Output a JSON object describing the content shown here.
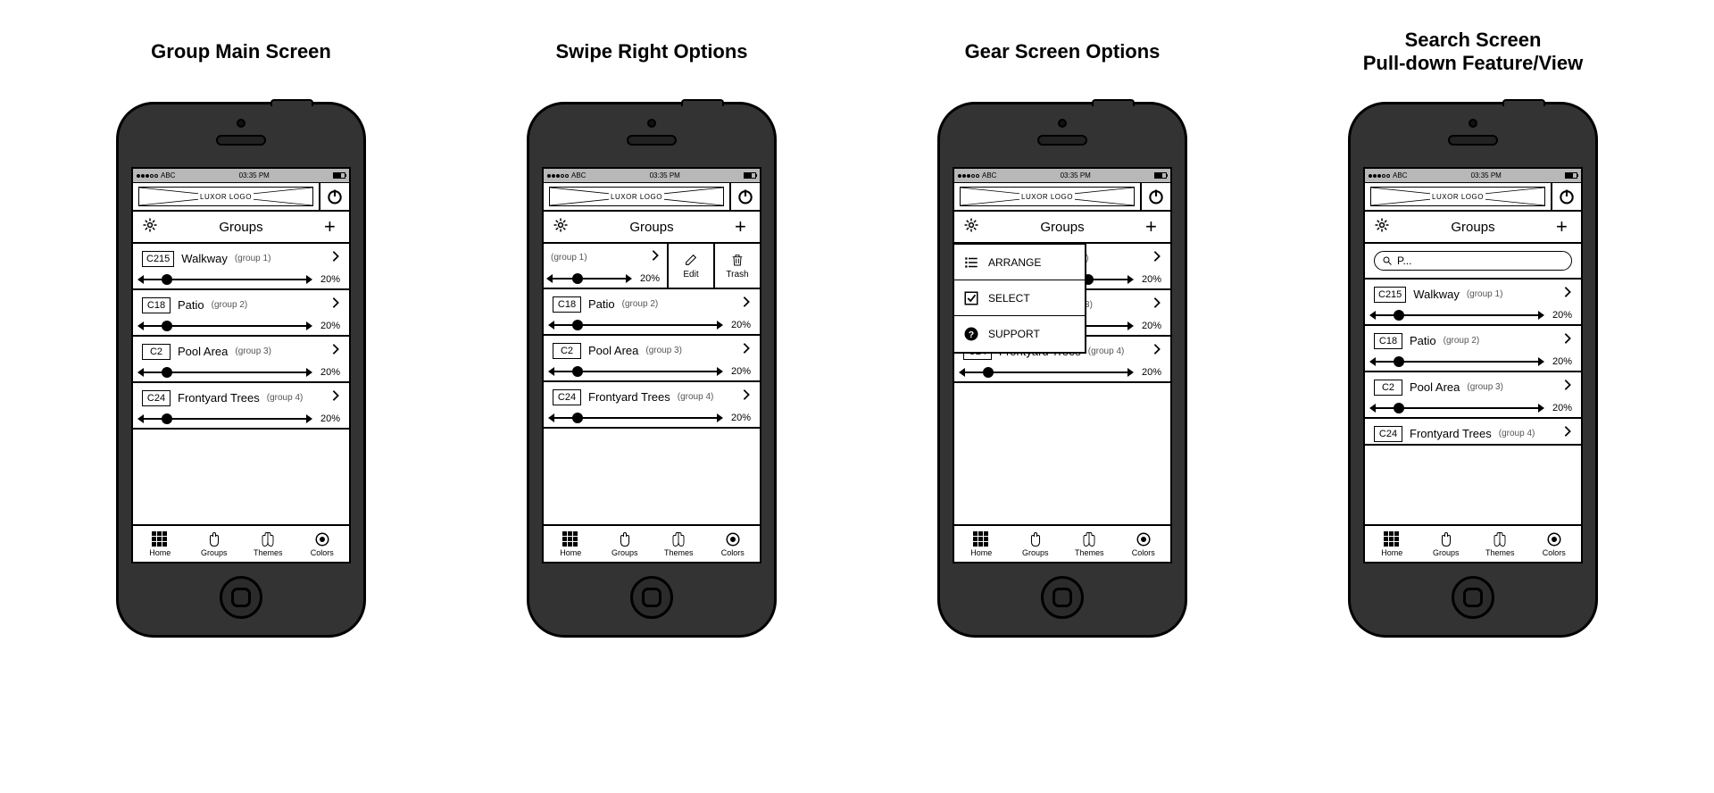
{
  "titles": [
    "Group Main Screen",
    "Swipe Right Options",
    "Gear Screen Options",
    "Search Screen\nPull-down Feature/View"
  ],
  "status": {
    "carrier": "ABC",
    "time": "03:35 PM"
  },
  "header": {
    "logo": "LUXOR LOGO"
  },
  "subheader": {
    "title": "Groups"
  },
  "groups": [
    {
      "chip": "C215",
      "name": "Walkway",
      "sub": "(group 1)",
      "pct": "20%",
      "knob": 12
    },
    {
      "chip": "C18",
      "name": "Patio",
      "sub": "(group 2)",
      "pct": "20%",
      "knob": 12
    },
    {
      "chip": "C2",
      "name": "Pool Area",
      "sub": "(group 3)",
      "pct": "20%",
      "knob": 12
    },
    {
      "chip": "C24",
      "name": "Frontyard Trees",
      "sub": "(group 4)",
      "pct": "20%",
      "knob": 12
    }
  ],
  "swipe": {
    "edit": "Edit",
    "trash": "Trash"
  },
  "gearmenu": [
    {
      "icon": "list",
      "label": "ARRANGE"
    },
    {
      "icon": "check",
      "label": "SELECT"
    },
    {
      "icon": "help",
      "label": "SUPPORT"
    }
  ],
  "search": {
    "value": "P..."
  },
  "tabs": [
    {
      "icon": "grid",
      "label": "Home"
    },
    {
      "icon": "groups",
      "label": "Groups"
    },
    {
      "icon": "themes",
      "label": "Themes"
    },
    {
      "icon": "colors",
      "label": "Colors"
    }
  ]
}
